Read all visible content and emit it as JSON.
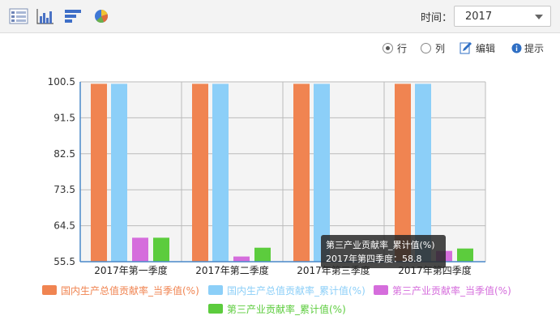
{
  "toolbar": {
    "icons": [
      "table-icon",
      "column-chart-icon",
      "bar-chart-icon",
      "pie-chart-icon"
    ],
    "time_label": "时间：",
    "time_value": "2017"
  },
  "options": {
    "row_label": "行",
    "col_label": "列",
    "edit_label": "编辑",
    "tip_label": "提示",
    "selected": "row"
  },
  "tooltip": {
    "title": "第三产业贡献率_累计值(%)",
    "line": "2017年第四季度：58.8"
  },
  "chart_data": {
    "type": "bar",
    "categories": [
      "2017年第一季度",
      "2017年第二季度",
      "2017年第三季度",
      "2017年第四季度"
    ],
    "series": [
      {
        "name": "国内生产总值贡献率_当季值(%)",
        "color": "#f08451",
        "values": [
          100,
          100,
          100,
          100
        ]
      },
      {
        "name": "国内生产总值贡献率_累计值(%)",
        "color": "#8ccff8",
        "values": [
          100,
          100,
          100,
          100
        ]
      },
      {
        "name": "第三产业贡献率_当季值(%)",
        "color": "#d56ddc",
        "values": [
          61.5,
          56.8,
          55.5,
          58.2
        ]
      },
      {
        "name": "第三产业贡献率_累计值(%)",
        "color": "#5ccc3d",
        "values": [
          61.5,
          59.0,
          55.5,
          58.8
        ]
      }
    ],
    "yticks": [
      55.5,
      64.5,
      73.5,
      82.5,
      91.5,
      100.5
    ],
    "ylim": [
      55.5,
      100.5
    ],
    "title": "",
    "xlabel": "",
    "ylabel": "",
    "grid": true,
    "legend": "bottom"
  }
}
